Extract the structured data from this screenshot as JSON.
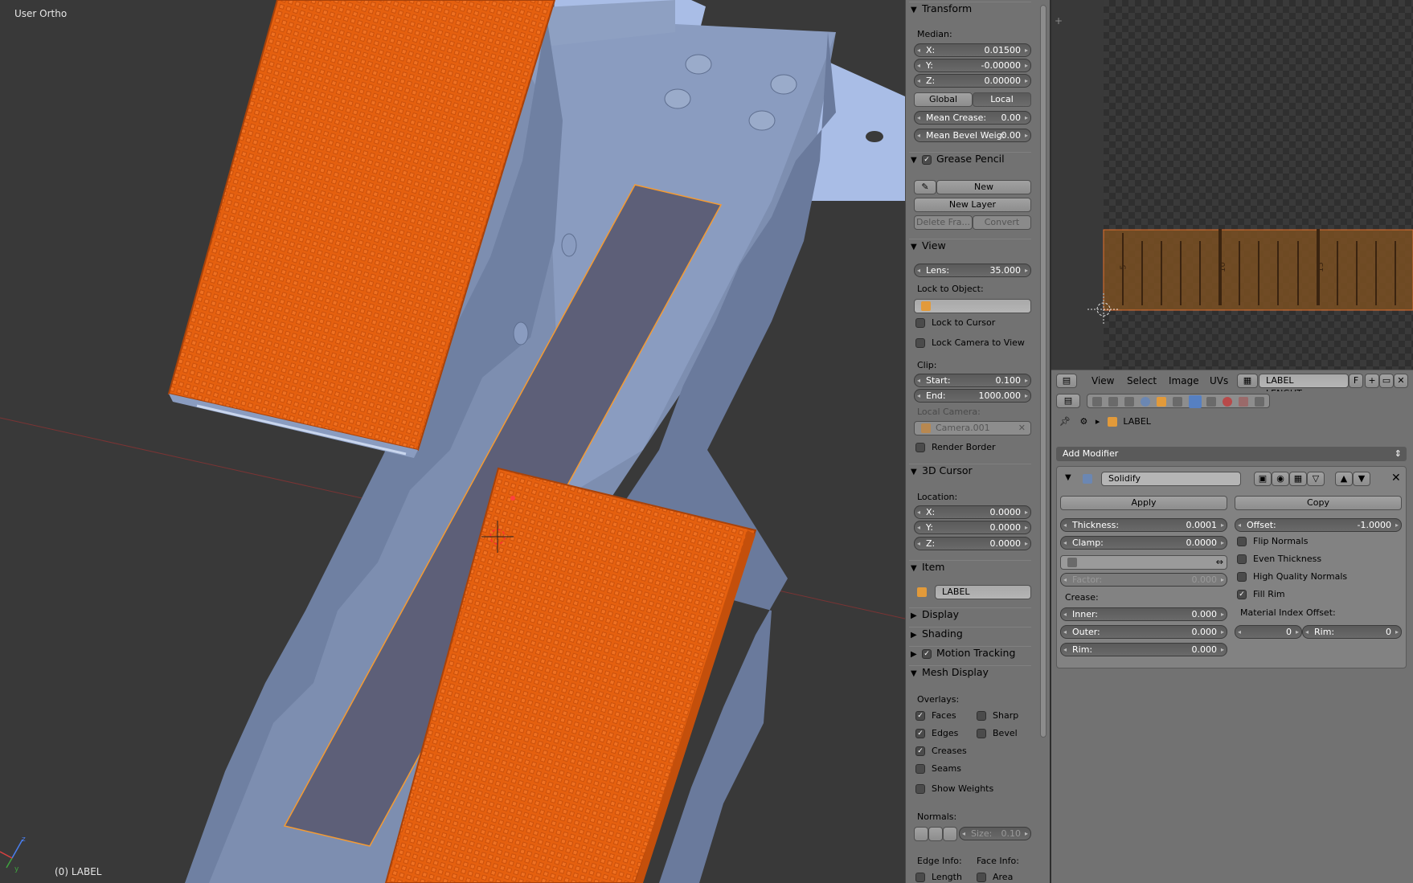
{
  "viewport": {
    "view_label": "User Ortho",
    "object_label": "(0) LABEL",
    "axis_labels": {
      "y": "y",
      "z": "z"
    }
  },
  "npanel": {
    "transform": {
      "title": "Transform",
      "median_label": "Median:",
      "x": {
        "label": "X:",
        "value": "0.01500"
      },
      "y": {
        "label": "Y:",
        "value": "-0.00000"
      },
      "z": {
        "label": "Z:",
        "value": "0.00000"
      },
      "global_label": "Global",
      "local_label": "Local",
      "mean_crease": {
        "label": "Mean Crease:",
        "value": "0.00"
      },
      "mean_bevel": {
        "label": "Mean Bevel Weig:",
        "value": "0.00"
      }
    },
    "grease_pencil": {
      "title": "Grease Pencil",
      "new_label": "New",
      "new_layer_label": "New Layer",
      "delete_frame_label": "Delete Fra...",
      "convert_label": "Convert"
    },
    "view": {
      "title": "View",
      "lens": {
        "label": "Lens:",
        "value": "35.000"
      },
      "lock_to_object_label": "Lock to Object:",
      "lock_to_cursor_label": "Lock to Cursor",
      "lock_camera_label": "Lock Camera to View",
      "clip_label": "Clip:",
      "start": {
        "label": "Start:",
        "value": "0.100"
      },
      "end": {
        "label": "End:",
        "value": "1000.000"
      },
      "local_camera_label": "Local Camera:",
      "local_camera_value": "Camera.001",
      "render_border_label": "Render Border"
    },
    "cursor3d": {
      "title": "3D Cursor",
      "location_label": "Location:",
      "x": {
        "label": "X:",
        "value": "0.0000"
      },
      "y": {
        "label": "Y:",
        "value": "0.0000"
      },
      "z": {
        "label": "Z:",
        "value": "0.0000"
      }
    },
    "item": {
      "title": "Item",
      "name": "LABEL"
    },
    "display_title": "Display",
    "shading_title": "Shading",
    "motion_tracking_title": "Motion Tracking",
    "mesh_display": {
      "title": "Mesh Display",
      "overlays_label": "Overlays:",
      "faces": "Faces",
      "sharp": "Sharp",
      "edges": "Edges",
      "bevel": "Bevel",
      "creases": "Creases",
      "seams": "Seams",
      "show_weights": "Show Weights",
      "normals_label": "Normals:",
      "size": {
        "label": "Size:",
        "value": "0.10"
      },
      "edge_info_label": "Edge Info:",
      "face_info_label": "Face Info:",
      "length": "Length",
      "area": "Area"
    }
  },
  "image_editor": {
    "ruler_marks": [
      "5",
      "10",
      "15"
    ],
    "menus": [
      "View",
      "Select",
      "Image",
      "UVs"
    ],
    "image_name": "LABEL LENGHT.png",
    "fake_user": "F"
  },
  "properties": {
    "breadcrumb_object": "LABEL",
    "add_modifier_label": "Add Modifier",
    "modifier": {
      "name": "Solidify",
      "apply_label": "Apply",
      "copy_label": "Copy",
      "thickness": {
        "label": "Thickness:",
        "value": "0.0001"
      },
      "offset": {
        "label": "Offset:",
        "value": "-1.0000"
      },
      "clamp": {
        "label": "Clamp:",
        "value": "0.0000"
      },
      "flip_normals": "Flip Normals",
      "even_thickness": "Even Thickness",
      "high_quality_normals": "High Quality Normals",
      "fill_rim": "Fill Rim",
      "factor": {
        "label": "Factor:",
        "value": "0.000"
      },
      "crease_label": "Crease:",
      "inner": {
        "label": "Inner:",
        "value": "0.000"
      },
      "outer": {
        "label": "Outer:",
        "value": "0.000"
      },
      "rim": {
        "label": "Rim:",
        "value": "0.000"
      },
      "material_index_offset_label": "Material Index Offset:",
      "mat_offset_value": "0",
      "mat_rim": {
        "label": "Rim:",
        "value": "0"
      }
    }
  },
  "colors": {
    "viewport_bg": "#393939",
    "orange": "#e5600f",
    "mesh_blue": "#8696b6",
    "panel_bg": "#727272",
    "selection_orange": "#f59b32"
  }
}
